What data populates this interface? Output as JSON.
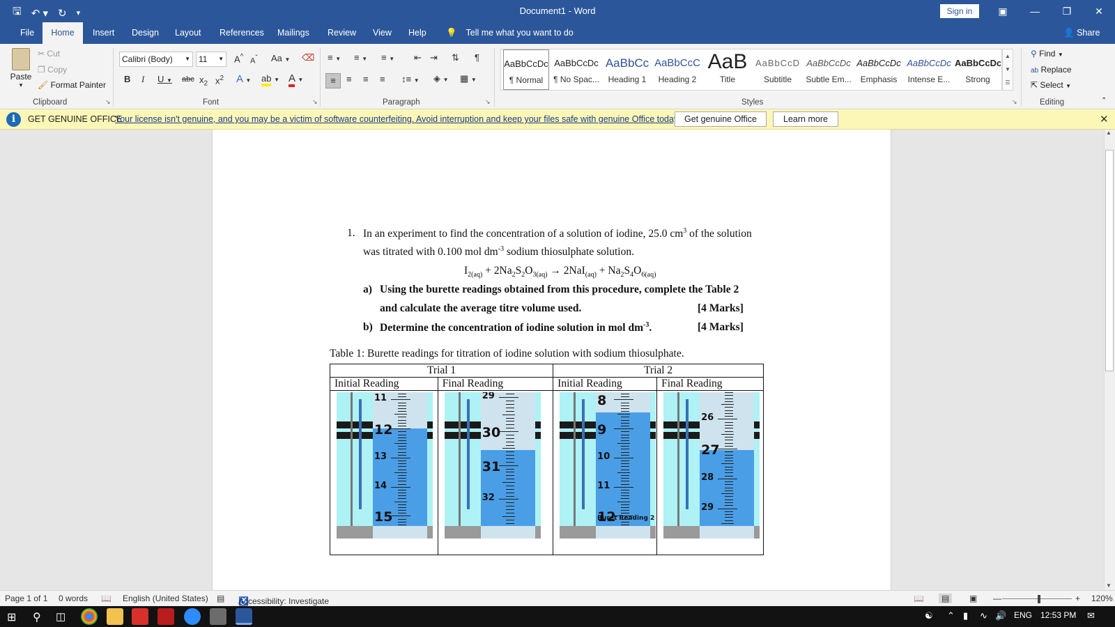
{
  "titlebar": {
    "title": "Document1  -  Word",
    "signin": "Sign in",
    "qat": [
      "save-icon",
      "undo-icon",
      "redo-icon",
      "customize-icon"
    ],
    "controls": [
      "ribbon-display-icon",
      "minimize-icon",
      "maximize-icon",
      "close-icon"
    ]
  },
  "tabs": {
    "file": "File",
    "home": "Home",
    "insert": "Insert",
    "design": "Design",
    "layout": "Layout",
    "references": "References",
    "mailings": "Mailings",
    "review": "Review",
    "view": "View",
    "help": "Help",
    "tellme": "Tell me what you want to do",
    "share": "Share"
  },
  "ribbon": {
    "clipboard": {
      "label": "Clipboard",
      "paste": "Paste",
      "cut": "Cut",
      "copy": "Copy",
      "format_painter": "Format Painter"
    },
    "font": {
      "label": "Font",
      "family": "Calibri (Body)",
      "size": "11",
      "case": "Aa"
    },
    "paragraph": {
      "label": "Paragraph"
    },
    "styles": {
      "label": "Styles",
      "items": [
        {
          "preview": "AaBbCcDc",
          "name": "¶ Normal"
        },
        {
          "preview": "AaBbCcDc",
          "name": "¶ No Spac..."
        },
        {
          "preview": "AaBbCc",
          "name": "Heading 1"
        },
        {
          "preview": "AaBbCcC",
          "name": "Heading 2"
        },
        {
          "preview": "AaB",
          "name": "Title"
        },
        {
          "preview": "AaBbCcD",
          "name": "Subtitle"
        },
        {
          "preview": "AaBbCcDc",
          "name": "Subtle Em..."
        },
        {
          "preview": "AaBbCcDc",
          "name": "Emphasis"
        },
        {
          "preview": "AaBbCcDc",
          "name": "Intense E..."
        },
        {
          "preview": "AaBbCcDc",
          "name": "Strong"
        }
      ]
    },
    "editing": {
      "label": "Editing",
      "find": "Find",
      "replace": "Replace",
      "select": "Select"
    }
  },
  "genuine_bar": {
    "title": "GET GENUINE OFFICE",
    "message": "Your license isn't genuine, and you may be a victim of software counterfeiting. Avoid interruption and keep your files safe with genuine Office today.",
    "get_button": "Get genuine Office",
    "learn_button": "Learn more"
  },
  "document": {
    "q_number": "1.",
    "q_line1": "In an experiment to find the concentration of a solution of iodine, 25.0 cm",
    "q_line1_sup": "3",
    "q_line1_end": " of the solution",
    "q_line2": "was titrated with 0.100 mol dm",
    "q_line2_sup": "-3",
    "q_line2_end": " sodium thiosulphate solution.",
    "equation": {
      "p1": "I",
      "p1s": "2(aq)",
      "p2": " + 2Na",
      "p2s": "2",
      "p3": "S",
      "p3s": "2",
      "p4": "O",
      "p4s": "3(aq)",
      "p5": " → 2NaI",
      "p5s": "(aq)",
      "p6": " + Na",
      "p6s": "2",
      "p7": "S",
      "p7s": "4",
      "p8": "O",
      "p8s": "6(aq)"
    },
    "part_a_label": "a)",
    "part_a_line1": "Using the burette readings obtained from this procedure, complete the Table 2",
    "part_a_line2": "and calculate the average titre volume used.",
    "part_a_marks": "[4 Marks]",
    "part_b_label": "b)",
    "part_b_text": "Determine the concentration of iodine solution in mol dm",
    "part_b_sup": "-3",
    "part_b_end": ".",
    "part_b_marks": "[4 Marks]",
    "table_caption": "Table 1: Burette readings for titration of iodine solution with sodium thiosulphate.",
    "table": {
      "trial1": "Trial 1",
      "trial2": "Trial 2",
      "headers": [
        "Initial Reading",
        "Final Reading",
        "Initial Reading",
        "Final Reading"
      ],
      "burettes": [
        {
          "labels": [
            "11",
            "12",
            "13",
            "14",
            "15"
          ],
          "level": 12.0,
          "top": 10.75,
          "bottom": 15.3
        },
        {
          "labels": [
            "29",
            "30",
            "31",
            "32"
          ],
          "level": 30.55,
          "top": 28.85,
          "bottom": 32.75
        },
        {
          "labels": [
            "8",
            "9",
            "10",
            "11",
            "12"
          ],
          "level": 8.45,
          "top": 7.75,
          "bottom": 12.3,
          "caption": "Buret Reading 2"
        },
        {
          "labels": [
            "26",
            "27",
            "28",
            "29"
          ],
          "level": 27.05,
          "top": 25.1,
          "bottom": 29.55
        }
      ]
    }
  },
  "statusbar": {
    "page": "Page 1 of 1",
    "words": "0 words",
    "language": "English (United States)",
    "accessibility": "Accessibility: Investigate",
    "zoom": "120%"
  },
  "taskbar": {
    "lang": "ENG",
    "time": "12:53 PM"
  },
  "colors": {
    "word_blue": "#2b579a",
    "banner_yellow": "#fcf7b6",
    "burette_liquid": "#4a9ee6",
    "burette_bg": "#aef2f5"
  }
}
